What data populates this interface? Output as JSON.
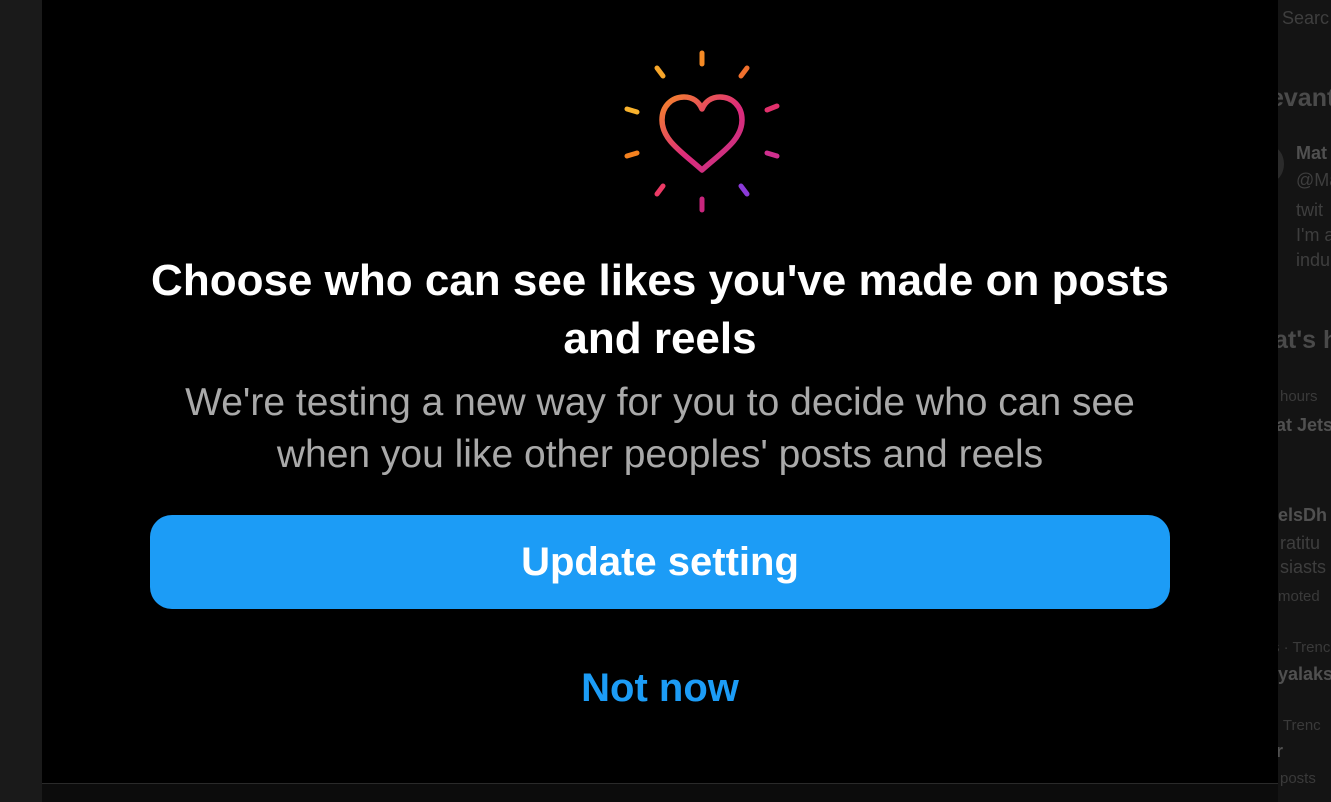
{
  "modal": {
    "icon": "heart-burst-icon",
    "title": "Choose who can see likes you've made on posts and reels",
    "subtitle": "We're testing a new way for you to decide who can see when you like other peoples' posts and reels",
    "primary_button": "Update setting",
    "secondary_button": "Not now"
  },
  "background_sidebar": {
    "search_placeholder": "Searc",
    "relevant_heading": "evant",
    "account_name": "Mat",
    "account_handle": "@Ma",
    "bio_line_1": "twit",
    "bio_line_2": "I'm a",
    "bio_line_3": "indu",
    "trends_heading": "at's h",
    "trend_1_meta": "hours",
    "trend_1_title": "at Jets",
    "trend_2_title": "elsDh",
    "trend_2_line_1": "ratitu",
    "trend_2_line_2": "siasts",
    "trend_2_meta": "moted",
    "trend_3_meta": "s · Trenc",
    "trend_3_title": "yalaks",
    "trend_4_meta": "· Trenc",
    "trend_4_title": "r",
    "trend_4_count": "posts"
  },
  "colors": {
    "modal_background": "#000000",
    "accent_blue": "#1c9cf6",
    "title_text": "#ffffff",
    "subtitle_text": "#a9a9a9",
    "gradient_orange": "#f58529",
    "gradient_pink": "#dd2a7b",
    "gradient_purple": "#8134af"
  }
}
